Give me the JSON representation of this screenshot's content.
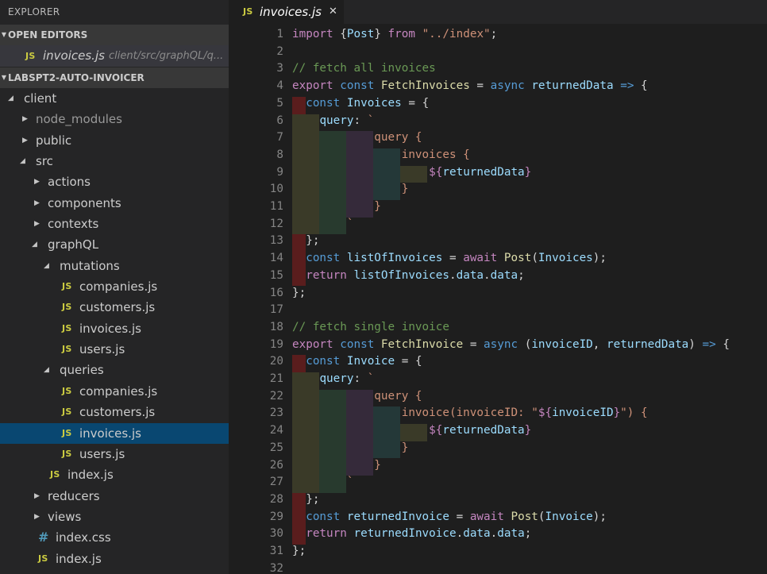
{
  "sidebar": {
    "title": "EXPLORER",
    "open_editors": {
      "header": "OPEN EDITORS",
      "items": [
        {
          "badge": "JS",
          "name": "invoices.js",
          "path": "client/src/graphQL/q..."
        }
      ]
    },
    "project": {
      "header": "LABSPT2-AUTO-INVOICER",
      "tree": [
        {
          "label": "client",
          "kind": "folder",
          "open": true,
          "depth": 0
        },
        {
          "label": "node_modules",
          "kind": "folder",
          "open": false,
          "depth": 1,
          "dim": true
        },
        {
          "label": "public",
          "kind": "folder",
          "open": false,
          "depth": 1
        },
        {
          "label": "src",
          "kind": "folder",
          "open": true,
          "depth": 1
        },
        {
          "label": "actions",
          "kind": "folder",
          "open": false,
          "depth": 2
        },
        {
          "label": "components",
          "kind": "folder",
          "open": false,
          "depth": 2
        },
        {
          "label": "contexts",
          "kind": "folder",
          "open": false,
          "depth": 2
        },
        {
          "label": "graphQL",
          "kind": "folder",
          "open": true,
          "depth": 2
        },
        {
          "label": "mutations",
          "kind": "folder",
          "open": true,
          "depth": 3
        },
        {
          "label": "companies.js",
          "kind": "js",
          "depth": 4
        },
        {
          "label": "customers.js",
          "kind": "js",
          "depth": 4
        },
        {
          "label": "invoices.js",
          "kind": "js",
          "depth": 4
        },
        {
          "label": "users.js",
          "kind": "js",
          "depth": 4
        },
        {
          "label": "queries",
          "kind": "folder",
          "open": true,
          "depth": 3
        },
        {
          "label": "companies.js",
          "kind": "js",
          "depth": 4
        },
        {
          "label": "customers.js",
          "kind": "js",
          "depth": 4
        },
        {
          "label": "invoices.js",
          "kind": "js",
          "depth": 4,
          "selected": true
        },
        {
          "label": "users.js",
          "kind": "js",
          "depth": 4
        },
        {
          "label": "index.js",
          "kind": "js",
          "depth": 3
        },
        {
          "label": "reducers",
          "kind": "folder",
          "open": false,
          "depth": 2
        },
        {
          "label": "views",
          "kind": "folder",
          "open": false,
          "depth": 2
        },
        {
          "label": "index.css",
          "kind": "css",
          "depth": 2
        },
        {
          "label": "index.js",
          "kind": "js",
          "depth": 2
        }
      ]
    }
  },
  "editor": {
    "tab": {
      "badge": "JS",
      "title": "invoices.js",
      "close": "✕"
    },
    "lines": [
      [
        [
          "kw",
          "import "
        ],
        [
          "pl",
          "{"
        ],
        [
          "var",
          "Post"
        ],
        [
          "pl",
          "} "
        ],
        [
          "kw",
          "from "
        ],
        [
          "str",
          "\"../index\""
        ],
        [
          "pl",
          ";"
        ]
      ],
      [],
      [
        [
          "com",
          "// fetch all invoices"
        ]
      ],
      [
        [
          "kw",
          "export "
        ],
        [
          "st",
          "const "
        ],
        [
          "fn",
          "FetchInvoices"
        ],
        [
          "pl",
          " = "
        ],
        [
          "st",
          "async "
        ],
        [
          "var",
          "returnedData"
        ],
        [
          "st",
          " => "
        ],
        [
          "pl",
          "{"
        ]
      ],
      [
        [
          "pl",
          "  "
        ],
        [
          "st",
          "const "
        ],
        [
          "var",
          "Invoices"
        ],
        [
          "pl",
          " = {"
        ]
      ],
      [
        [
          "pl",
          "    "
        ],
        [
          "var",
          "query"
        ],
        [
          "pl",
          ": "
        ],
        [
          "str",
          "`"
        ]
      ],
      [
        [
          "str",
          "            query {"
        ]
      ],
      [
        [
          "str",
          "                invoices {"
        ]
      ],
      [
        [
          "str",
          "                    "
        ],
        [
          "kw",
          "${"
        ],
        [
          "tv",
          "returnedData"
        ],
        [
          "kw",
          "}"
        ]
      ],
      [
        [
          "str",
          "                }"
        ]
      ],
      [
        [
          "str",
          "            }"
        ]
      ],
      [
        [
          "str",
          "        `"
        ]
      ],
      [
        [
          "pl",
          "  };"
        ]
      ],
      [
        [
          "pl",
          "  "
        ],
        [
          "st",
          "const "
        ],
        [
          "var",
          "listOfInvoices"
        ],
        [
          "pl",
          " = "
        ],
        [
          "kw",
          "await "
        ],
        [
          "fn",
          "Post"
        ],
        [
          "pl",
          "("
        ],
        [
          "var",
          "Invoices"
        ],
        [
          "pl",
          ");"
        ]
      ],
      [
        [
          "pl",
          "  "
        ],
        [
          "kw",
          "return "
        ],
        [
          "var",
          "listOfInvoices"
        ],
        [
          "pl",
          "."
        ],
        [
          "var",
          "data"
        ],
        [
          "pl",
          "."
        ],
        [
          "var",
          "data"
        ],
        [
          "pl",
          ";"
        ]
      ],
      [
        [
          "pl",
          "};"
        ]
      ],
      [],
      [
        [
          "com",
          "// fetch single invoice"
        ]
      ],
      [
        [
          "kw",
          "export "
        ],
        [
          "st",
          "const "
        ],
        [
          "fn",
          "FetchInvoice"
        ],
        [
          "pl",
          " = "
        ],
        [
          "st",
          "async "
        ],
        [
          "pl",
          "("
        ],
        [
          "var",
          "invoiceID"
        ],
        [
          "pl",
          ", "
        ],
        [
          "var",
          "returnedData"
        ],
        [
          "pl",
          ") "
        ],
        [
          "st",
          "=> "
        ],
        [
          "pl",
          "{"
        ]
      ],
      [
        [
          "pl",
          "  "
        ],
        [
          "st",
          "const "
        ],
        [
          "var",
          "Invoice"
        ],
        [
          "pl",
          " = {"
        ]
      ],
      [
        [
          "pl",
          "    "
        ],
        [
          "var",
          "query"
        ],
        [
          "pl",
          ": "
        ],
        [
          "str",
          "`"
        ]
      ],
      [
        [
          "str",
          "            query {"
        ]
      ],
      [
        [
          "str",
          "                invoice(invoiceID: \""
        ],
        [
          "kw",
          "${"
        ],
        [
          "tv",
          "invoiceID"
        ],
        [
          "kw",
          "}"
        ],
        [
          "str",
          "\") {"
        ]
      ],
      [
        [
          "str",
          "                    "
        ],
        [
          "kw",
          "${"
        ],
        [
          "tv",
          "returnedData"
        ],
        [
          "kw",
          "}"
        ]
      ],
      [
        [
          "str",
          "                }"
        ]
      ],
      [
        [
          "str",
          "            }"
        ]
      ],
      [
        [
          "str",
          "        `"
        ]
      ],
      [
        [
          "pl",
          "  };"
        ]
      ],
      [
        [
          "pl",
          "  "
        ],
        [
          "st",
          "const "
        ],
        [
          "var",
          "returnedInvoice"
        ],
        [
          "pl",
          " = "
        ],
        [
          "kw",
          "await "
        ],
        [
          "fn",
          "Post"
        ],
        [
          "pl",
          "("
        ],
        [
          "var",
          "Invoice"
        ],
        [
          "pl",
          ");"
        ]
      ],
      [
        [
          "pl",
          "  "
        ],
        [
          "kw",
          "return "
        ],
        [
          "var",
          "returnedInvoice"
        ],
        [
          "pl",
          "."
        ],
        [
          "var",
          "data"
        ],
        [
          "pl",
          "."
        ],
        [
          "var",
          "data"
        ],
        [
          "pl",
          ";"
        ]
      ],
      [
        [
          "pl",
          "};"
        ]
      ],
      []
    ],
    "indent_colors": [
      "#5a1d1d",
      "#3a3a28",
      "#283a2e",
      "#352a3a",
      "#243838"
    ]
  }
}
